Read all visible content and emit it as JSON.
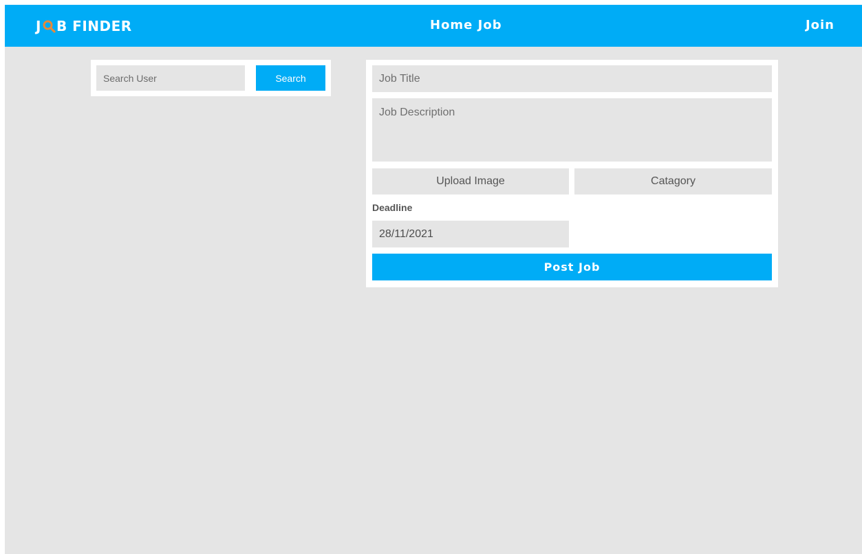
{
  "brand": {
    "name_prefix": "J",
    "name_suffix": "B FINDER",
    "accent_color": "#e8893a"
  },
  "nav": {
    "center_label": "Home Job",
    "join_label": "Join",
    "bar_color": "#00acf6"
  },
  "search": {
    "placeholder": "Search User",
    "button_label": "Search"
  },
  "post_form": {
    "job_title_placeholder": "Job Title",
    "job_description_placeholder": "Job Description",
    "upload_image_label": "Upload Image",
    "category_label": "Catagory",
    "deadline_label": "Deadline",
    "deadline_value": "28/11/2021",
    "post_button_label": "Post Job"
  },
  "colors": {
    "primary": "#00acf6",
    "background": "#e5e5e5",
    "card": "#ffffff"
  }
}
